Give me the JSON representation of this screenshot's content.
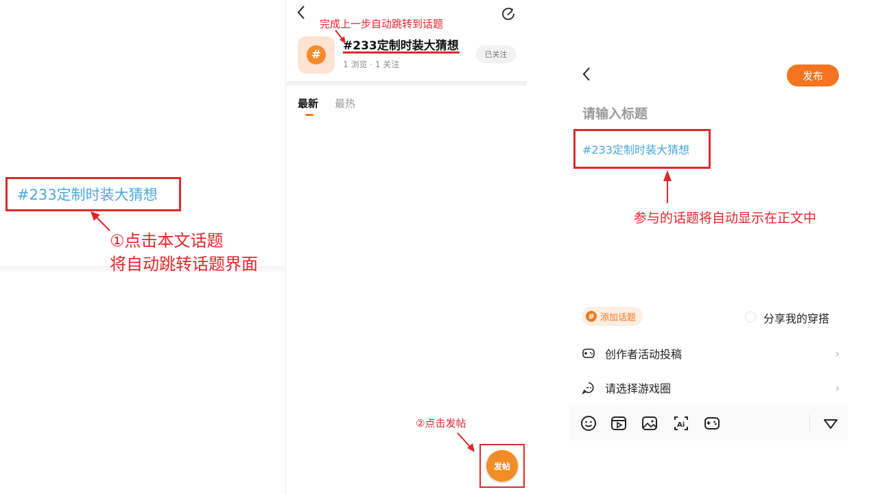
{
  "left": {
    "topic_link": "#233定制时装大猜想",
    "step1_line1": "①点击本文话题",
    "step1_line2": "将自动跳转话题界面"
  },
  "middle": {
    "annotation": "完成上一步自动跳转到话题",
    "topic_title": "#233定制时装大猜想",
    "topic_stats": "1 浏览 · 1 关注",
    "follow_status": "已关注",
    "tabs": [
      "最新",
      "最热"
    ],
    "step2": "②点击发帖",
    "post_button_label": "发帖"
  },
  "right": {
    "publish_label": "发布",
    "title_placeholder": "请输入标题",
    "body_topic": "#233定制时装大猜想",
    "annotation": "参与的话题将自动显示在正文中",
    "add_topic_label": "添加话题",
    "share_outfit_label": "分享我的穿搭",
    "creator_activity_label": "创作者活动投稿",
    "game_circle_label": "请选择游戏圈"
  },
  "icons": {
    "back": "chevron-left-icon",
    "share": "share-icon",
    "hash": "hash-icon",
    "toolbar": [
      "emoji-icon",
      "video-icon",
      "image-icon",
      "ai-icon",
      "gamepad-icon",
      "collapse-icon"
    ]
  },
  "colors": {
    "accent_orange": "#f47421",
    "annotation_red": "#e0262b",
    "topic_blue": "#4aa8dc"
  }
}
